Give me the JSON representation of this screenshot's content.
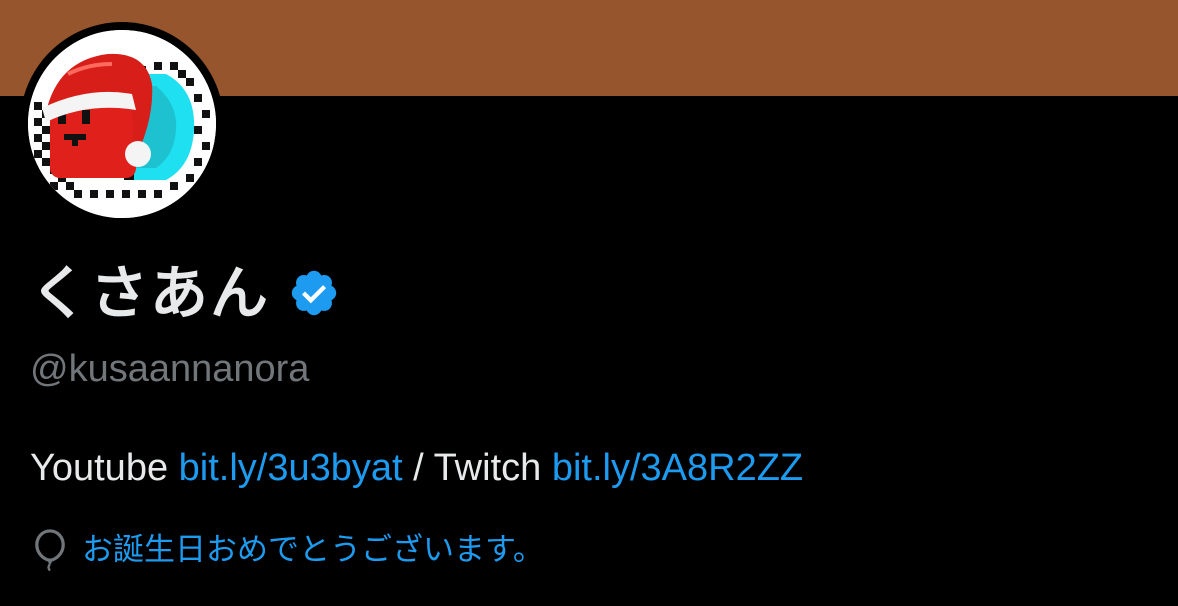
{
  "colors": {
    "banner": "#97552e",
    "background": "#000000",
    "text_primary": "#e7e9ea",
    "text_secondary": "#71767b",
    "accent": "#1d9bf0"
  },
  "profile": {
    "display_name": "くさあん",
    "verified": true,
    "handle": "@kusaannanora",
    "avatar_icon": "pixel-santa-taiko-avatar"
  },
  "bio": {
    "youtube_label": "Youtube ",
    "youtube_link": "bit.ly/3u3byat",
    "separator": " / Twitch ",
    "twitch_link": "bit.ly/3A8R2ZZ"
  },
  "birthday": {
    "icon": "balloon-icon",
    "text": "お誕生日おめでとうございます。"
  }
}
